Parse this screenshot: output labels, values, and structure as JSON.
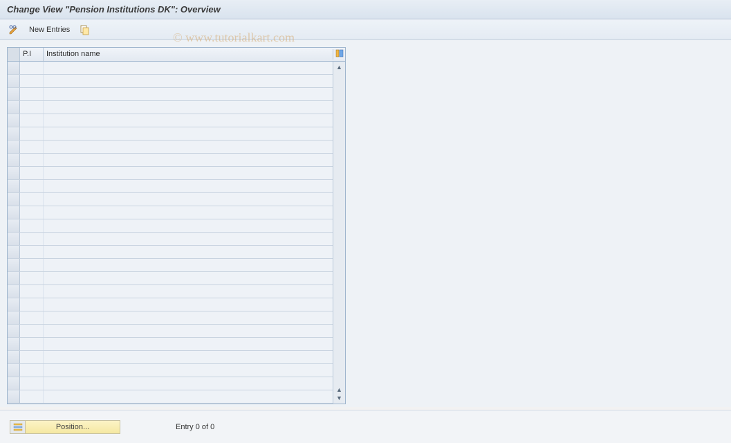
{
  "title": "Change View \"Pension Institutions DK\": Overview",
  "toolbar": {
    "new_entries_label": "New Entries"
  },
  "table": {
    "col_pi": "P.I",
    "col_name": "Institution name",
    "row_count": 26
  },
  "footer": {
    "position_label": "Position...",
    "entry_text": "Entry 0 of 0"
  },
  "watermark": "© www.tutorialkart.com"
}
